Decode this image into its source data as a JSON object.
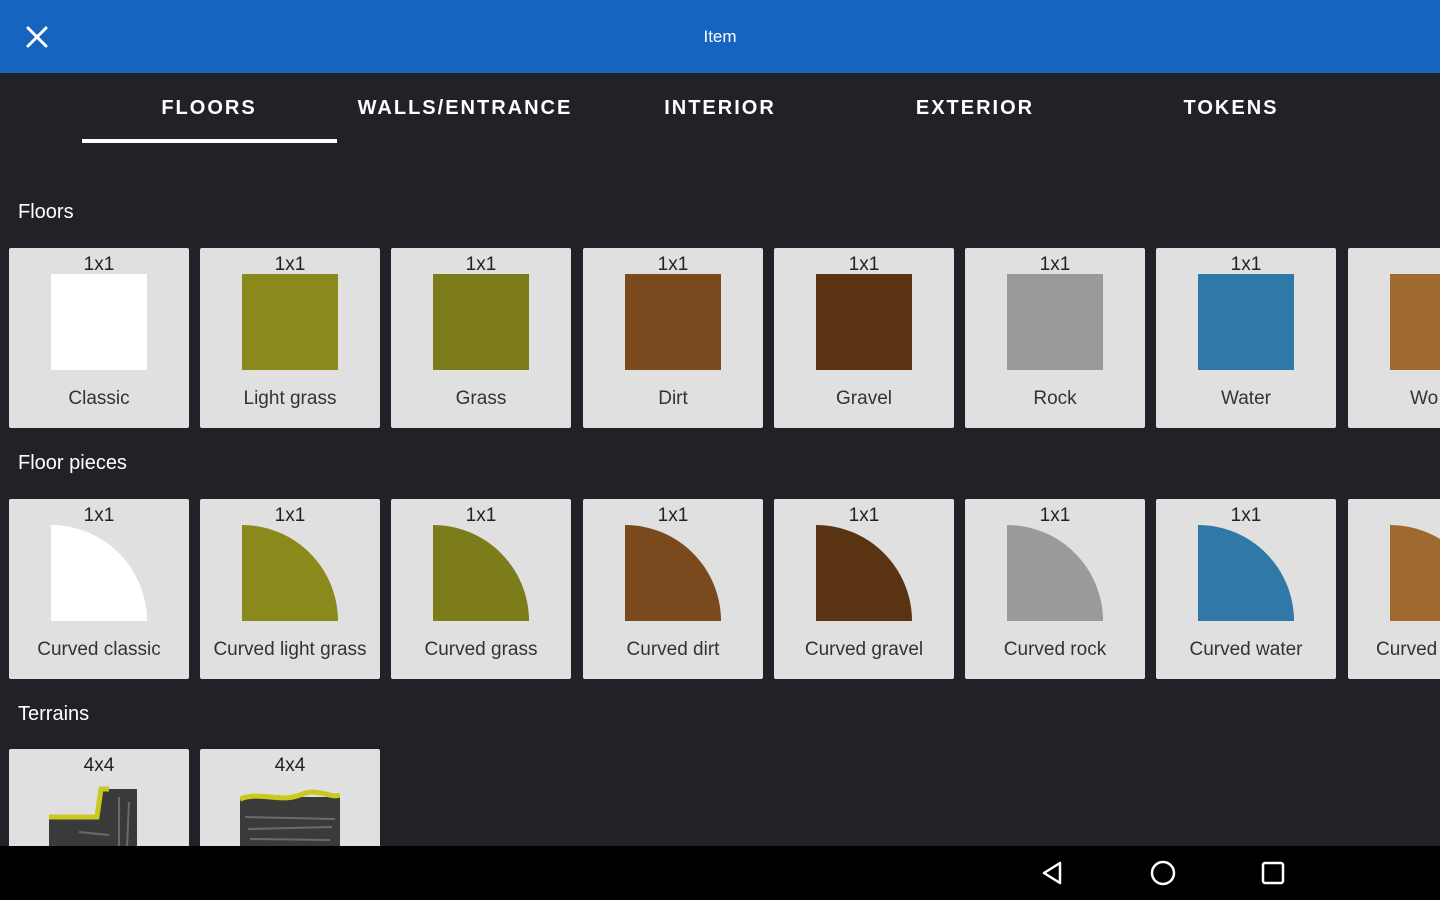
{
  "app": {
    "title": "Item"
  },
  "tabs": [
    "FLOORS",
    "WALLS/ENTRANCE",
    "INTERIOR",
    "EXTERIOR",
    "TOKENS"
  ],
  "active_tab": "FLOORS",
  "sections": {
    "floors": {
      "title": "Floors",
      "items": [
        {
          "size": "1x1",
          "label": "Classic",
          "color": "#ffffff"
        },
        {
          "size": "1x1",
          "label": "Light grass",
          "color": "#8a8a1c"
        },
        {
          "size": "1x1",
          "label": "Grass",
          "color": "#7c7c1a"
        },
        {
          "size": "1x1",
          "label": "Dirt",
          "color": "#7a4a1e"
        },
        {
          "size": "1x1",
          "label": "Gravel",
          "color": "#5a3412"
        },
        {
          "size": "1x1",
          "label": "Rock",
          "color": "#9a9a9a"
        },
        {
          "size": "1x1",
          "label": "Water",
          "color": "#2f78a8"
        },
        {
          "size": "1",
          "label": "Wo",
          "color": "#a06a2e"
        }
      ]
    },
    "floor_pieces": {
      "title": "Floor pieces",
      "items": [
        {
          "size": "1x1",
          "label": "Curved classic",
          "color": "#ffffff"
        },
        {
          "size": "1x1",
          "label": "Curved light grass",
          "color": "#8a8a1c"
        },
        {
          "size": "1x1",
          "label": "Curved grass",
          "color": "#7c7c1a"
        },
        {
          "size": "1x1",
          "label": "Curved dirt",
          "color": "#7a4a1e"
        },
        {
          "size": "1x1",
          "label": "Curved gravel",
          "color": "#5a3412"
        },
        {
          "size": "1x1",
          "label": "Curved rock",
          "color": "#9a9a9a"
        },
        {
          "size": "1x1",
          "label": "Curved water",
          "color": "#2f78a8"
        },
        {
          "size": "1",
          "label": "Curved",
          "color": "#a06a2e"
        }
      ]
    },
    "terrains": {
      "title": "Terrains",
      "items": [
        {
          "size": "4x4",
          "label": ""
        },
        {
          "size": "4x4",
          "label": ""
        }
      ]
    }
  },
  "nav": {
    "back_icon": "back-triangle-icon",
    "home_icon": "home-circle-icon",
    "recents_icon": "recents-square-icon"
  }
}
